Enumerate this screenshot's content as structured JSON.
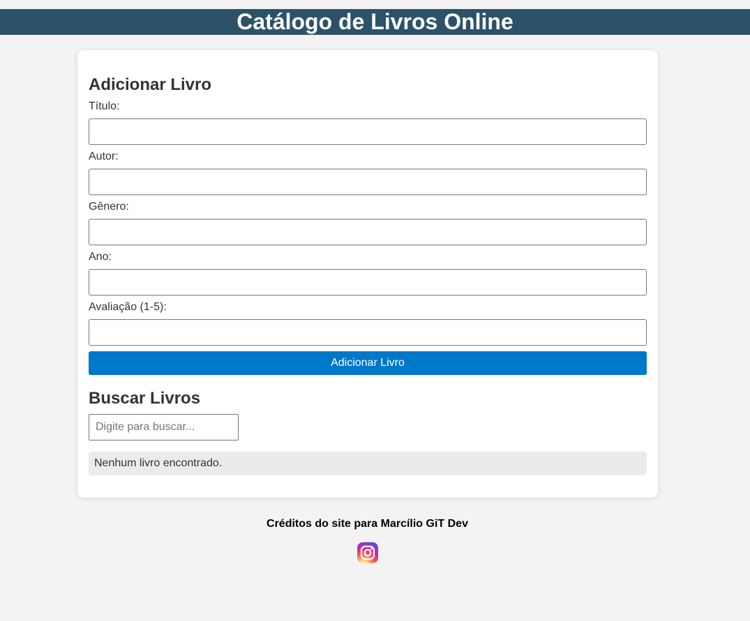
{
  "header": {
    "title": "Catálogo de Livros Online"
  },
  "add_form": {
    "heading": "Adicionar Livro",
    "fields": [
      {
        "label": "Título:",
        "value": ""
      },
      {
        "label": "Autor:",
        "value": ""
      },
      {
        "label": "Gênero:",
        "value": ""
      },
      {
        "label": "Ano:",
        "value": ""
      },
      {
        "label": "Avaliação (1-5):",
        "value": ""
      }
    ],
    "submit_label": "Adicionar Livro"
  },
  "search": {
    "heading": "Buscar Livros",
    "placeholder": "Digite para buscar...",
    "value": "",
    "result_message": "Nenhum livro encontrado."
  },
  "footer": {
    "credits": "Créditos do site para Marcílio GiT Dev",
    "social_icon": "instagram-icon"
  },
  "colors": {
    "header_bg": "#2c5269",
    "button_bg": "#0078c9",
    "page_bg": "#f3f3f3",
    "result_bg": "#ebebeb"
  }
}
